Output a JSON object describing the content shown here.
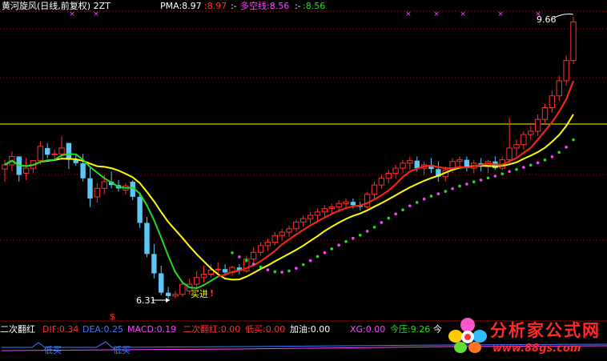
{
  "header": {
    "title": "黄河旋风(日线,前复权) 2ZT",
    "pma_label": "PMA:8.97",
    "pma_value": ":8.97",
    "sep1": ":-",
    "dkx_label": "多空线:8.56",
    "sep2": ":-",
    "dkx_value": ":8.56"
  },
  "annotations": {
    "high": "9.66",
    "low": "6.31",
    "buy": "买进",
    "buy_mark": "!",
    "dollar": "$"
  },
  "indicator": {
    "name": "二次翻红",
    "dif": "DIF:0.34",
    "dea": "DEA:0.25",
    "macd": "MACD:0.19",
    "ercifanhong": "二次翻红:0.00",
    "dimai": "低买:0.00",
    "jiayou": "加油:0.00",
    "xg": "XG:0.00",
    "jinya": "今压:9.26",
    "jin_cut": "今",
    "low_buy": "低买",
    "low_buy_cut": "低买"
  },
  "watermark": {
    "name": "分析家公式网",
    "url": "www.88gs.com"
  },
  "colors": {
    "up": "#ff3030",
    "down": "#5bc8f5",
    "yellow": "#ffff00",
    "green": "#22dd22",
    "red_line": "#ff1a1a",
    "magenta": "#ff44ff",
    "white": "#ffffff",
    "separator": "#9c0000"
  },
  "chart_data": {
    "type": "candlestick",
    "price_low": 6.31,
    "price_high": 9.66,
    "reference_line": 8.97,
    "candles": [
      [
        7.85,
        7.96,
        7.7,
        7.9
      ],
      [
        7.9,
        8.06,
        7.82,
        8.0
      ],
      [
        8.0,
        8.0,
        7.7,
        7.78
      ],
      [
        7.8,
        7.98,
        7.72,
        7.86
      ],
      [
        7.86,
        7.95,
        7.8,
        7.95
      ],
      [
        7.95,
        8.18,
        7.9,
        8.12
      ],
      [
        8.1,
        8.16,
        7.98,
        8.02
      ],
      [
        8.02,
        8.08,
        7.96,
        8.03
      ],
      [
        8.03,
        8.24,
        7.98,
        8.1
      ],
      [
        8.16,
        8.16,
        7.85,
        7.96
      ],
      [
        7.96,
        8.02,
        7.89,
        7.92
      ],
      [
        7.92,
        8.03,
        7.7,
        7.74
      ],
      [
        7.74,
        7.88,
        7.4,
        7.5
      ],
      [
        7.52,
        7.68,
        7.45,
        7.62
      ],
      [
        7.62,
        7.78,
        7.55,
        7.7
      ],
      [
        7.7,
        7.82,
        7.62,
        7.66
      ],
      [
        7.66,
        7.72,
        7.58,
        7.62
      ],
      [
        7.6,
        7.68,
        7.55,
        7.65
      ],
      [
        7.7,
        7.72,
        7.48,
        7.52
      ],
      [
        7.52,
        7.56,
        7.15,
        7.21
      ],
      [
        7.21,
        7.28,
        6.8,
        6.84
      ],
      [
        6.84,
        6.96,
        6.55,
        6.61
      ],
      [
        6.61,
        6.7,
        6.35,
        6.38
      ],
      [
        6.38,
        6.45,
        6.31,
        6.34
      ],
      [
        6.34,
        6.4,
        6.31,
        6.36
      ],
      [
        6.36,
        6.52,
        6.33,
        6.48
      ],
      [
        6.4,
        6.55,
        6.36,
        6.48
      ],
      [
        6.48,
        6.64,
        6.44,
        6.56
      ],
      [
        6.56,
        6.7,
        6.5,
        6.6
      ],
      [
        6.6,
        6.72,
        6.56,
        6.65
      ],
      [
        6.65,
        6.74,
        6.6,
        6.66
      ],
      [
        6.66,
        6.72,
        6.58,
        6.62
      ],
      [
        6.62,
        6.7,
        6.58,
        6.68
      ],
      [
        6.68,
        6.72,
        6.6,
        6.64
      ],
      [
        6.64,
        6.82,
        6.62,
        6.78
      ],
      [
        6.78,
        6.92,
        6.74,
        6.86
      ],
      [
        6.86,
        6.98,
        6.82,
        6.94
      ],
      [
        6.94,
        7.02,
        6.88,
        6.98
      ],
      [
        6.98,
        7.1,
        6.94,
        7.06
      ],
      [
        7.06,
        7.14,
        7.0,
        7.1
      ],
      [
        7.1,
        7.18,
        7.04,
        7.14
      ],
      [
        7.14,
        7.25,
        7.1,
        7.22
      ],
      [
        7.22,
        7.3,
        7.16,
        7.26
      ],
      [
        7.26,
        7.34,
        7.2,
        7.3
      ],
      [
        7.3,
        7.38,
        7.24,
        7.34
      ],
      [
        7.34,
        7.42,
        7.28,
        7.38
      ],
      [
        7.38,
        7.44,
        7.32,
        7.4
      ],
      [
        7.4,
        7.48,
        7.34,
        7.44
      ],
      [
        7.44,
        7.5,
        7.38,
        7.46
      ],
      [
        7.46,
        7.5,
        7.38,
        7.42
      ],
      [
        7.42,
        7.46,
        7.36,
        7.4
      ],
      [
        7.4,
        7.58,
        7.38,
        7.55
      ],
      [
        7.55,
        7.7,
        7.5,
        7.66
      ],
      [
        7.66,
        7.78,
        7.62,
        7.74
      ],
      [
        7.74,
        7.84,
        7.68,
        7.8
      ],
      [
        7.8,
        7.9,
        7.74,
        7.86
      ],
      [
        7.86,
        7.96,
        7.8,
        7.92
      ],
      [
        7.92,
        8.0,
        7.84,
        7.95
      ],
      [
        7.95,
        8.0,
        7.82,
        7.86
      ],
      [
        7.86,
        7.94,
        7.78,
        7.9
      ],
      [
        7.9,
        7.98,
        7.8,
        7.85
      ],
      [
        7.85,
        7.94,
        7.7,
        7.76
      ],
      [
        7.76,
        7.88,
        7.7,
        7.84
      ],
      [
        7.84,
        7.98,
        7.8,
        7.94
      ],
      [
        7.94,
        8.0,
        7.88,
        7.96
      ],
      [
        7.96,
        8.0,
        7.82,
        7.86
      ],
      [
        7.86,
        7.96,
        7.8,
        7.92
      ],
      [
        7.92,
        7.98,
        7.82,
        7.88
      ],
      [
        7.88,
        7.96,
        7.8,
        7.94
      ],
      [
        7.94,
        8.0,
        7.84,
        7.86
      ],
      [
        7.86,
        8.0,
        7.84,
        7.96
      ],
      [
        7.96,
        8.46,
        7.9,
        8.1
      ],
      [
        8.1,
        8.2,
        8.0,
        8.14
      ],
      [
        8.14,
        8.3,
        8.08,
        8.26
      ],
      [
        8.26,
        8.36,
        8.2,
        8.3
      ],
      [
        8.3,
        8.5,
        8.24,
        8.44
      ],
      [
        8.44,
        8.62,
        8.4,
        8.58
      ],
      [
        8.58,
        8.78,
        8.52,
        8.72
      ],
      [
        8.72,
        8.96,
        8.66,
        8.9
      ],
      [
        8.9,
        9.2,
        8.84,
        9.14
      ],
      [
        9.14,
        9.66,
        9.1,
        9.6
      ]
    ]
  }
}
